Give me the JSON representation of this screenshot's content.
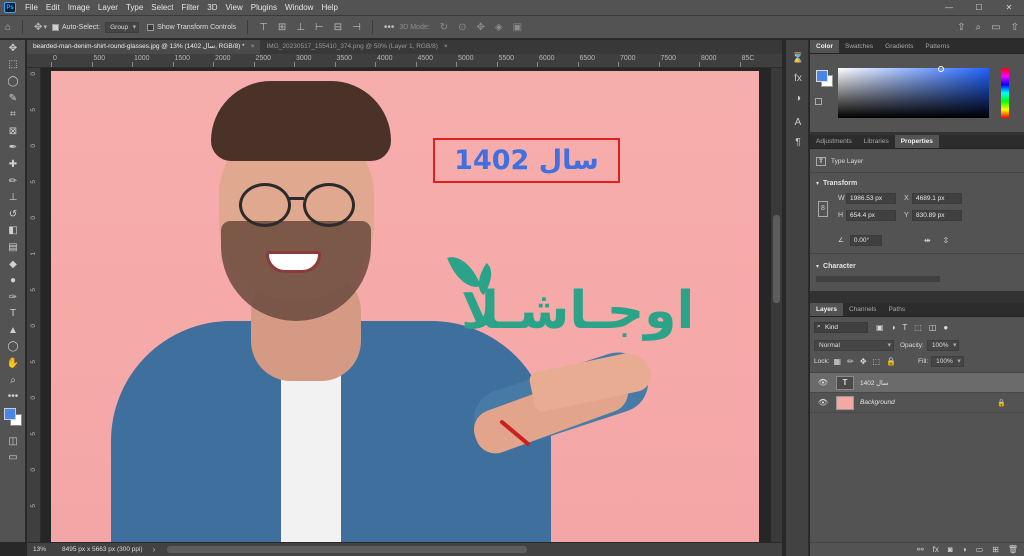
{
  "app": {
    "logo": "Ps"
  },
  "menu": [
    "File",
    "Edit",
    "Image",
    "Layer",
    "Type",
    "Select",
    "Filter",
    "3D",
    "View",
    "Plugins",
    "Window",
    "Help"
  ],
  "window_controls": {
    "minimize": "—",
    "maximize": "☐",
    "close": "✕"
  },
  "options": {
    "auto_select_label": "Auto-Select:",
    "auto_select_checked": true,
    "auto_select_value": "Group",
    "transform_label": "Show Transform Controls",
    "transform_checked": false,
    "mode_3d_label": "3D Mode:",
    "more": "•••"
  },
  "tabs": [
    {
      "label": "bearded-man-denim-shirt-round-glasses.jpg @ 13% (1402 سال, RGB/8) *",
      "close": "×",
      "active": true
    },
    {
      "label": "IMG_20230517_155410_374.png @ 50% (Layer 1, RGB/8)",
      "close": "×",
      "active": false
    }
  ],
  "ruler": {
    "top": [
      "0",
      "500",
      "1000",
      "1500",
      "2000",
      "2500",
      "3000",
      "3500",
      "4000",
      "4500",
      "5000",
      "5500",
      "6000",
      "6500",
      "7000",
      "7500",
      "8000",
      "85C"
    ],
    "left": [
      "0",
      "5",
      "0",
      "5",
      "0",
      "1",
      "5",
      "0",
      "5",
      "0",
      "5",
      "0",
      "5"
    ]
  },
  "canvas": {
    "title_text": "سال 1402",
    "title_color": "#3f6fe0",
    "box_color": "#e02020",
    "logo_text": "اوجـاشـلا",
    "logo_color": "#2aa389",
    "background_color": "#f5a9a8"
  },
  "status": {
    "zoom": "13%",
    "doc_info": "8495 px x 5663 px (300 ppi)",
    "arrow": "›"
  },
  "color_panel": {
    "tabs": [
      "Color",
      "Swatches",
      "Gradients",
      "Patterns"
    ],
    "active_tab": "Color",
    "foreground": "#4a86e8",
    "background": "#ffffff"
  },
  "properties_panel": {
    "tabs": [
      "Adjustments",
      "Libraries",
      "Properties"
    ],
    "active_tab": "Properties",
    "layer_type": "Type Layer",
    "transform_header": "Transform",
    "w_label": "W",
    "w_value": "1986.53 px",
    "x_label": "X",
    "x_value": "4689.1 px",
    "h_label": "H",
    "h_value": "654.4 px",
    "y_label": "Y",
    "y_value": "830.89 px",
    "angle": "0.00°",
    "character_header": "Character"
  },
  "layers_panel": {
    "tabs": [
      "Layers",
      "Channels",
      "Paths"
    ],
    "active_tab": "Layers",
    "kind_label": "Kind",
    "blend_mode": "Normal",
    "opacity_label": "Opacity:",
    "opacity_value": "100%",
    "lock_label": "Lock:",
    "fill_label": "Fill:",
    "fill_value": "100%",
    "layers": [
      {
        "name": "سال 1402",
        "thumb": "T",
        "visible": true,
        "selected": true
      },
      {
        "name": "Background",
        "thumb": "",
        "visible": true,
        "selected": false,
        "locked": true
      }
    ],
    "footer_icons": [
      "link-icon",
      "fx-icon",
      "mask-icon",
      "adjustment-icon",
      "folder-icon",
      "new-layer-icon",
      "trash-icon"
    ]
  }
}
